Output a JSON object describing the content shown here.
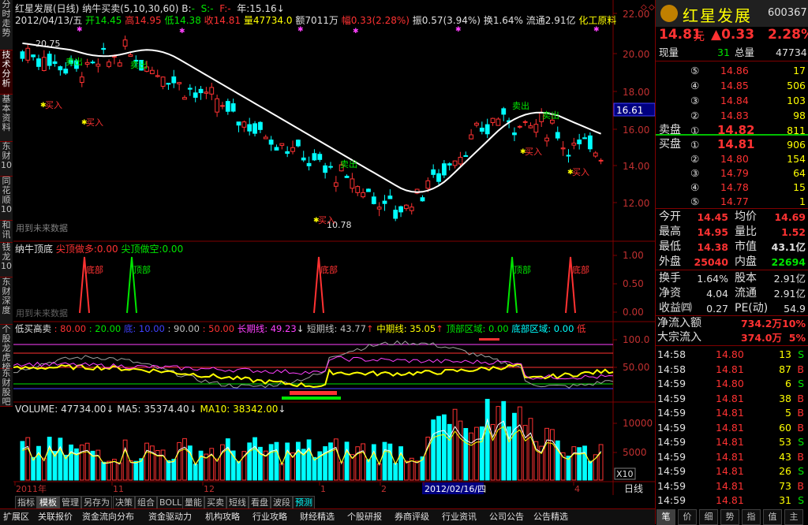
{
  "left_tabs": [
    "分时走势",
    "技术分析",
    "基本资料",
    "东财10",
    "同花顺10",
    "和讯",
    "钱龙10",
    "东财深度",
    "个股龙虎榜",
    "东财股吧"
  ],
  "header": {
    "stock_name": "红星发展(日线)",
    "indicator": "纳牛买卖(5,10,30,60)",
    "b_label": "B:",
    "b_val": "-",
    "s_label": "S:",
    "s_val": "-",
    "f_label": "F:",
    "f_val": "-",
    "year_label": "年:",
    "year_val": "15.16",
    "date": "2012/04/13/五",
    "open_label": "开",
    "open": "14.45",
    "high_label": "高",
    "high": "14.95",
    "low_label": "低",
    "low": "14.38",
    "close_label": "收",
    "close": "14.81",
    "vol_label": "量",
    "vol": "47734.0",
    "amt_label": "额",
    "amt": "7011万",
    "chg_label": "幅",
    "chg": "0.33(2.28%)",
    "amp_label": "振",
    "amp": "0.57(3.94%)",
    "turn_label": "换",
    "turn": "1.64%",
    "float_label": "流通",
    "float": "2.91亿",
    "industry": "化工原料"
  },
  "main_chart": {
    "y_ticks": [
      "22.00",
      "20.00",
      "18.00",
      "16.00",
      "14.00",
      "12.00"
    ],
    "highlight_price": "16.61",
    "max_label": "20.75",
    "min_label": "10.78",
    "signals_sell": [
      "卖出",
      "卖出",
      "卖出",
      "卖出",
      "卖出"
    ],
    "signals_buy": [
      "买入",
      "买入",
      "买入",
      "买入",
      "买入"
    ],
    "footnote": "用到未来数据"
  },
  "panel2": {
    "title": "纳牛顶底",
    "l1": "尖顶做多:",
    "v1": "0.00",
    "l2": "尖顶做空:",
    "v2": "0.00",
    "y_ticks": [
      "1.00",
      "0.50",
      "0.00"
    ],
    "labels": [
      "底部",
      "顶部",
      "底部",
      "顶部",
      "底部"
    ],
    "footnote": "用到未来数据"
  },
  "panel3": {
    "title": "低买高卖",
    "items": [
      ": 80.00",
      ": 20.00",
      "底: 10.00",
      ": 90.00",
      ": 50.00",
      "长期线: 49.23",
      "短期线: 43.77",
      "中期线: 35.05",
      "顶部区域: 0.00",
      "底部区域: 0.00",
      "低"
    ],
    "y_ticks": [
      "100.0",
      "50.00"
    ]
  },
  "panel4": {
    "vol_label": "VOLUME: 47734.00",
    "ma5_label": "MA5: 35374.40",
    "ma10_label": "MA10: 38342.00",
    "y_ticks": [
      "10000",
      "5000"
    ],
    "unit": "X10"
  },
  "x_axis": {
    "labels": [
      "2011年",
      "11",
      "12",
      "1",
      "2",
      "2012/02/16/四",
      "4"
    ],
    "period": "日线"
  },
  "toolbar1": [
    "指标",
    "模板",
    "管理",
    "另存为",
    "决策",
    "组合",
    "BOLL",
    "量能",
    "买卖",
    "短线",
    "看盘",
    "波段",
    "预测"
  ],
  "toolbar2": [
    "扩展区",
    "关联报价",
    "资金流向分布",
    "资金驱动力",
    "机构攻略",
    "行业攻略",
    "财经精选",
    "个股研报",
    "券商评级",
    "行业资讯",
    "公司公告",
    "公告精选"
  ],
  "right_panel": {
    "logo_text": "红星发展",
    "code": "600367",
    "price": "14.81",
    "price_unit": "元",
    "change": "▲0.33",
    "change_pct": "2.28%",
    "xianliang_label": "现量",
    "xianliang": "31",
    "zongliang_label": "总量",
    "zongliang": "47734",
    "asks": [
      {
        "lvl": "⑤",
        "price": "14.86",
        "vol": "17"
      },
      {
        "lvl": "④",
        "price": "14.85",
        "vol": "506"
      },
      {
        "lvl": "③",
        "price": "14.84",
        "vol": "103"
      },
      {
        "lvl": "②",
        "price": "14.83",
        "vol": "98"
      },
      {
        "lvl": "①",
        "price": "14.82",
        "vol": "811"
      }
    ],
    "sell_label": "卖盘",
    "buy_label": "买盘",
    "bids": [
      {
        "lvl": "①",
        "price": "14.81",
        "vol": "906"
      },
      {
        "lvl": "②",
        "price": "14.80",
        "vol": "154"
      },
      {
        "lvl": "③",
        "price": "14.79",
        "vol": "64"
      },
      {
        "lvl": "④",
        "price": "14.78",
        "vol": "15"
      },
      {
        "lvl": "⑤",
        "price": "14.77",
        "vol": "1"
      }
    ],
    "stats": [
      {
        "l1": "今开",
        "v1": "14.45",
        "c1": "red",
        "l2": "均价",
        "v2": "14.69",
        "c2": "red"
      },
      {
        "l1": "最高",
        "v1": "14.95",
        "c1": "red",
        "l2": "量比",
        "v2": "1.52",
        "c2": "red"
      },
      {
        "l1": "最低",
        "v1": "14.38",
        "c1": "red",
        "l2": "市值",
        "v2": "43.1亿",
        "c2": "white"
      },
      {
        "l1": "外盘",
        "v1": "25040",
        "c1": "red",
        "l2": "内盘",
        "v2": "22694",
        "c2": "green"
      }
    ],
    "stats2": [
      {
        "l1": "换手",
        "v1": "1.64%",
        "l2": "股本",
        "v2": "2.91亿"
      },
      {
        "l1": "净资",
        "v1": "4.04",
        "l2": "流通",
        "v2": "2.91亿"
      },
      {
        "l1": "收益㈣",
        "v1": "0.27",
        "l2": "PE(动)",
        "v2": "54.9"
      }
    ],
    "flow": [
      {
        "label": "净流入额",
        "val": "734.2万",
        "pct": "10%"
      },
      {
        "label": "大宗流入",
        "val": "374.0万",
        "pct": "5%"
      }
    ],
    "ticks": [
      {
        "t": "14:58",
        "p": "14.80",
        "v": "13",
        "d": "S"
      },
      {
        "t": "14:58",
        "p": "14.81",
        "v": "87",
        "d": "B"
      },
      {
        "t": "14:59",
        "p": "14.80",
        "v": "6",
        "d": "S"
      },
      {
        "t": "14:59",
        "p": "14.81",
        "v": "38",
        "d": "B"
      },
      {
        "t": "14:59",
        "p": "14.81",
        "v": "5",
        "d": "B"
      },
      {
        "t": "14:59",
        "p": "14.81",
        "v": "60",
        "d": "B"
      },
      {
        "t": "14:59",
        "p": "14.81",
        "v": "53",
        "d": "S"
      },
      {
        "t": "14:59",
        "p": "14.81",
        "v": "43",
        "d": "B"
      },
      {
        "t": "14:59",
        "p": "14.81",
        "v": "26",
        "d": "S"
      },
      {
        "t": "14:59",
        "p": "14.81",
        "v": "73",
        "d": "B"
      },
      {
        "t": "14:59",
        "p": "14.81",
        "v": "31",
        "d": "S"
      }
    ],
    "bottom_tabs": [
      "笔",
      "价",
      "细",
      "势",
      "指",
      "值",
      "主"
    ]
  },
  "colors": {
    "up": "#ff3232",
    "down": "#00ffff",
    "ma": "#ffffff",
    "accent_red": "#800000"
  }
}
